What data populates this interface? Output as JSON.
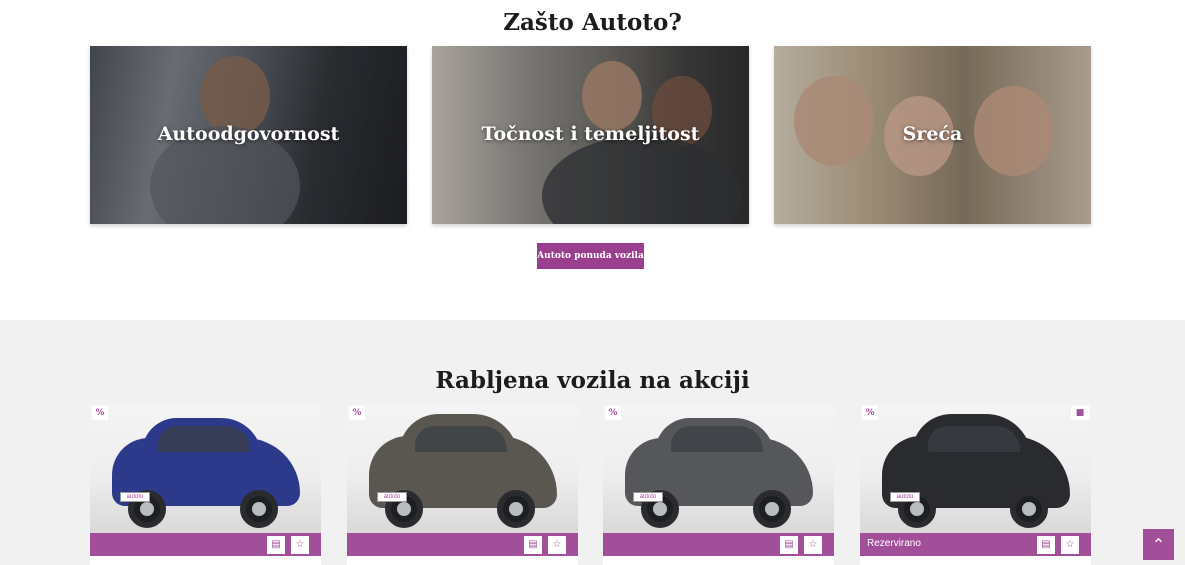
{
  "why_section": {
    "title": "Zašto Autoto?",
    "features": [
      {
        "label": "Autoodgovornost"
      },
      {
        "label": "Točnost i temeljitost"
      },
      {
        "label": "Sreća"
      }
    ],
    "cta_label": "Autoto ponuda vozila"
  },
  "sale_section": {
    "title": "Rabljena vozila na akciji",
    "cards": [
      {
        "badge": "%",
        "status": "",
        "plate": "autoto",
        "color": "#2d3a8c",
        "list_icon": "list-icon",
        "fav_icon": "star-icon"
      },
      {
        "badge": "%",
        "status": "",
        "plate": "autoto",
        "color": "#5a5751",
        "list_icon": "list-icon",
        "fav_icon": "star-icon"
      },
      {
        "badge": "%",
        "status": "",
        "plate": "autoto",
        "color": "#56575a",
        "list_icon": "list-icon",
        "fav_icon": "star-icon"
      },
      {
        "badge": "%",
        "status": "Rezervirano",
        "plate": "autoto",
        "color": "#2a2b2f",
        "list_icon": "list-icon",
        "fav_icon": "star-icon",
        "video_icon": "video-camera-icon"
      }
    ]
  },
  "icons": {
    "list": "▤",
    "star": "☆",
    "video": "■",
    "scroll_up": "⌃"
  },
  "colors": {
    "accent": "#a24f99",
    "cta": "#9a3f8e",
    "section_bg": "#f1f1f1"
  }
}
